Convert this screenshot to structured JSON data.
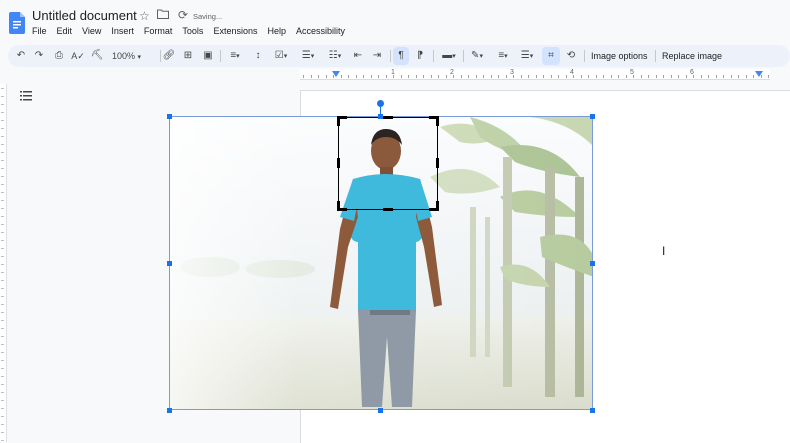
{
  "app": {
    "doc_title": "Untitled document",
    "status": "Saving...",
    "brand_color": "#4285f4"
  },
  "menu": [
    "File",
    "Edit",
    "View",
    "Insert",
    "Format",
    "Tools",
    "Extensions",
    "Help",
    "Accessibility"
  ],
  "toolbar": {
    "zoom": "100%",
    "image_options_label": "Image options",
    "replace_image_label": "Replace image",
    "icons": [
      "undo-icon",
      "redo-icon",
      "print-icon",
      "spellcheck-icon",
      "paint-format-icon",
      "zoom-select",
      "link-icon",
      "add-comment-icon",
      "insert-image-icon",
      "align-icon",
      "line-spacing-icon",
      "checklist-icon",
      "bulleted-list-icon",
      "numbered-list-icon",
      "decrease-indent-icon",
      "increase-indent-icon",
      "inline-text-icon",
      "wrap-text-icon",
      "border-color-icon",
      "border-weight-icon",
      "border-dash-icon",
      "crop-icon",
      "reset-image-icon"
    ],
    "active_color": "#d3e3fd"
  },
  "ruler": {
    "numbers": [
      "1",
      "1",
      "2",
      "3",
      "4",
      "5",
      "6"
    ]
  },
  "image": {
    "selection_color": "#1a73e8"
  }
}
